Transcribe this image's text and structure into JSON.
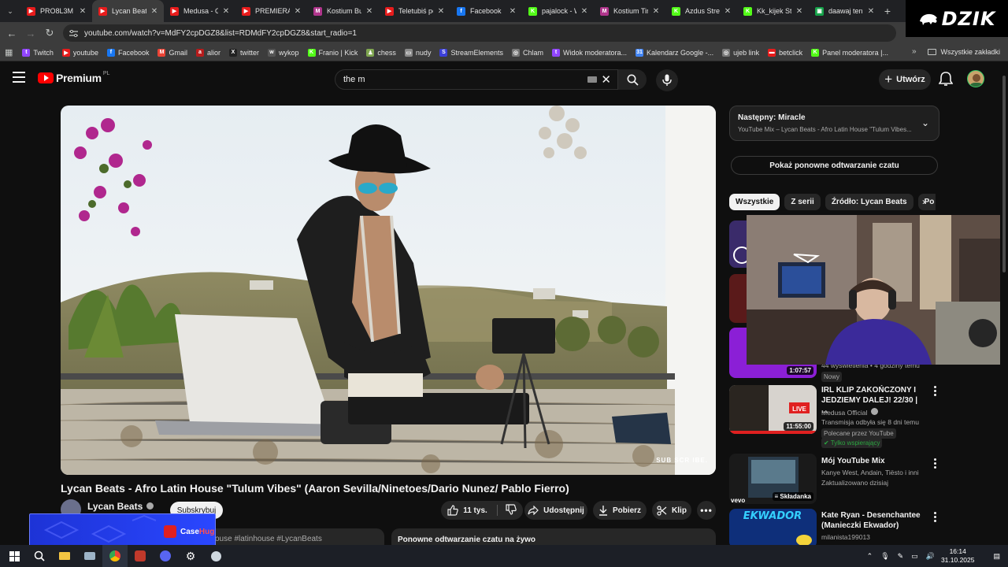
{
  "browser": {
    "tabs": [
      {
        "label": "PRO8L3M - ",
        "color": "#e81c1c",
        "glyph": "▶",
        "active": false
      },
      {
        "label": "Lycan Beats",
        "color": "#e81c1c",
        "glyph": "▶",
        "active": true
      },
      {
        "label": "Medusa - Gl",
        "color": "#e81c1c",
        "glyph": "▶",
        "active": false
      },
      {
        "label": "PREMIERA G",
        "color": "#e81c1c",
        "glyph": "▶",
        "active": false
      },
      {
        "label": "Kostium Butt",
        "color": "#b0358c",
        "glyph": "M",
        "active": false
      },
      {
        "label": "Teletubiś pe",
        "color": "#e81c1c",
        "glyph": "▶",
        "active": false
      },
      {
        "label": "Facebook",
        "color": "#1877f2",
        "glyph": "f",
        "active": false
      },
      {
        "label": "pajalock - W",
        "color": "#53fc18",
        "glyph": "K",
        "active": false
      },
      {
        "label": "Kostium Tini",
        "color": "#b0358c",
        "glyph": "M",
        "active": false
      },
      {
        "label": "Azdus Strea",
        "color": "#53fc18",
        "glyph": "K",
        "active": false
      },
      {
        "label": "Kk_kijek Stre",
        "color": "#53fc18",
        "glyph": "K",
        "active": false
      },
      {
        "label": "daawaj ten s",
        "color": "#16a34a",
        "glyph": "▣",
        "active": false
      }
    ],
    "url": "youtube.com/watch?v=MdFY2cpDGZ8&list=RDMdFY2cpDGZ8&start_radio=1",
    "bookmarks": [
      {
        "label": "Twitch",
        "color": "#9146ff",
        "glyph": "t"
      },
      {
        "label": "youtube",
        "color": "#e81c1c",
        "glyph": "▶"
      },
      {
        "label": "Facebook",
        "color": "#1877f2",
        "glyph": "f"
      },
      {
        "label": "Gmail",
        "color": "#ea4335",
        "glyph": "M"
      },
      {
        "label": "alior",
        "color": "#b71c1c",
        "glyph": "a"
      },
      {
        "label": "twitter",
        "color": "#222222",
        "glyph": "X"
      },
      {
        "label": "wykop",
        "color": "#555555",
        "glyph": "w"
      },
      {
        "label": "Franio | Kick",
        "color": "#53fc18",
        "glyph": "K"
      },
      {
        "label": "chess",
        "color": "#7fa650",
        "glyph": "♟"
      },
      {
        "label": "nudy",
        "color": "#8a8a8a",
        "glyph": "▭"
      },
      {
        "label": "StreamElements",
        "color": "#3b3fd8",
        "glyph": "S"
      },
      {
        "label": "Chlam",
        "color": "#777777",
        "glyph": "◎"
      },
      {
        "label": "Widok moderatora...",
        "color": "#9146ff",
        "glyph": "t"
      },
      {
        "label": "Kalendarz Google -...",
        "color": "#4285f4",
        "glyph": "31"
      },
      {
        "label": "ujeb link",
        "color": "#777777",
        "glyph": "◎"
      },
      {
        "label": "betclick",
        "color": "#e81c1c",
        "glyph": "▬"
      },
      {
        "label": "Panel moderatora |...",
        "color": "#53fc18",
        "glyph": "K"
      }
    ],
    "all_bookmarks": "Wszystkie zakładki",
    "dzik_logo": "DZIK"
  },
  "youtube": {
    "brand": "Premium",
    "region": "PL",
    "search_query": "the m",
    "create_label": "Utwórz",
    "video": {
      "title": "Lycan Beats - Afro Latin House \"Tulum Vibes\" (Aaron Sevilla/Ninetoes/Dario Nunez/ Pablo Fierro)",
      "watermark": "SUB SCR IBE.",
      "channel": "Lycan Beats",
      "subscribe": "Subskrybuj",
      "likes": "11 tys.",
      "share": "Udostępnij",
      "download": "Pobierz",
      "clip": "Klip",
      "description_snippet": "ouse #latinhouse #LycanBeats",
      "live_chat_replay": "Ponowne odtwarzanie czatu na żywo"
    },
    "sidebar": {
      "next_title": "Następny: Miracle",
      "next_sub": "YouTube Mix – Lycan Beats - Afro Latin House \"Tulum Vibes...",
      "show_chat_replay": "Pokaż ponowne odtwarzanie czatu",
      "chips": [
        "Wszystkie",
        "Z serii",
        "Źródło: Lycan Beats",
        "Po"
      ],
      "recs": [
        {
          "duration": "1:07:57",
          "meta1": "44 wyświetlenia • 4 godziny temu",
          "badge": "Nowy"
        },
        {
          "duration": "11:55:00",
          "title": "IRL KLIP ZAKOŃCZONY I JEDZIEMY DALEJ! 22/30 | ...",
          "channel": "Medusa Official",
          "meta1": "Transmisja odbyła się 8 dni temu",
          "badge": "Polecane przez YouTube",
          "badge2": "Tylko wspierający"
        },
        {
          "duration": "Składanka",
          "title": "Mój YouTube Mix",
          "channel": "Kanye West, Andain, Tiësto i inni",
          "meta1": "Zaktualizowano dzisiaj"
        },
        {
          "title": "Kate Ryan - Desenchantee (Manieczki Ekwador)",
          "channel": "milanista199013",
          "thumb_text": "EKWADOR"
        }
      ]
    }
  },
  "overlay": {
    "casehug_a": "Case",
    "casehug_b": "Hug"
  },
  "taskbar": {
    "time": "16:14",
    "date": "31.10.2025"
  }
}
